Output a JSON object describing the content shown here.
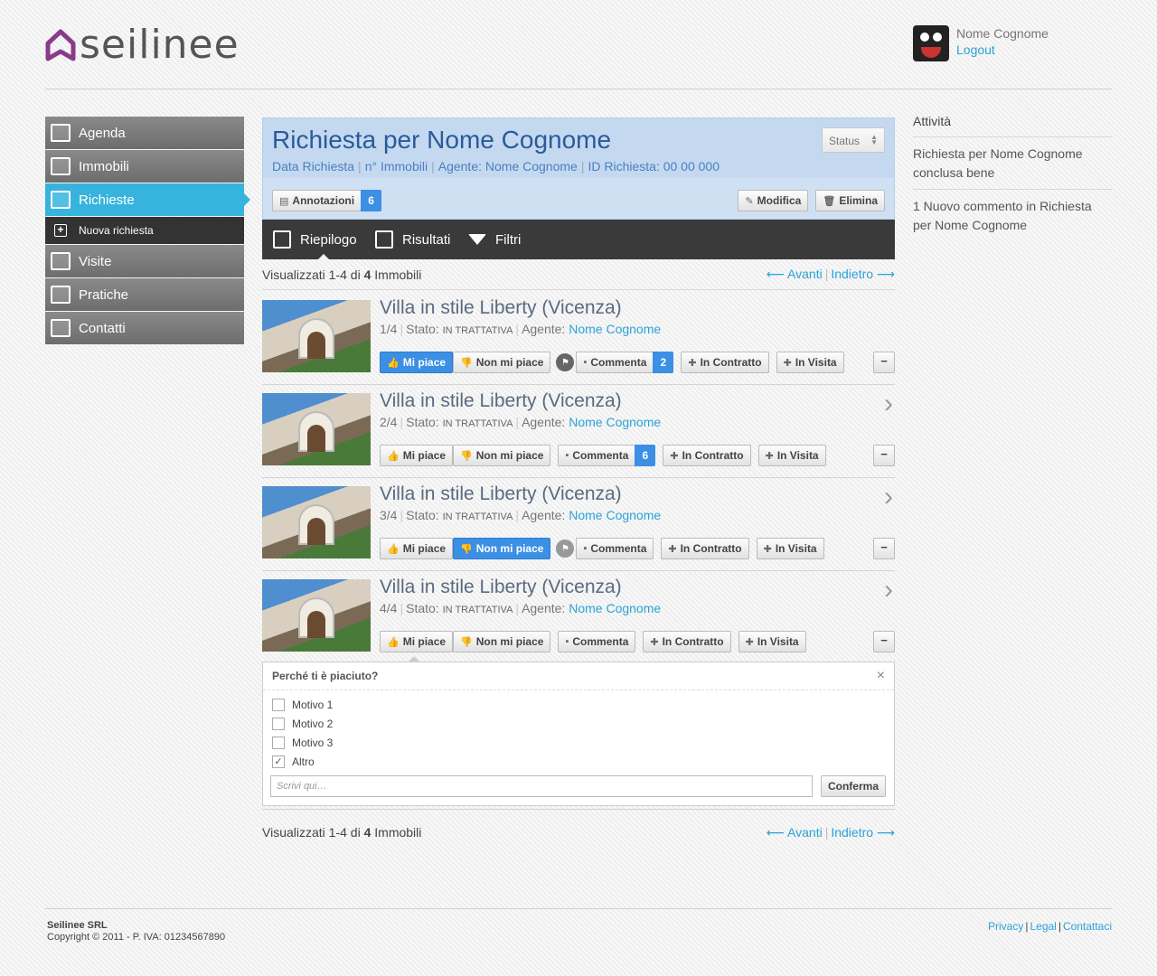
{
  "brand": {
    "logo_text": "seilinee",
    "accent": "#36b4dd",
    "logo_color": "#8a3a8a"
  },
  "user": {
    "name": "Nome Cognome",
    "logout": "Logout"
  },
  "sidebar": {
    "items": [
      {
        "label": "Agenda",
        "icon": "calendar-icon"
      },
      {
        "label": "Immobili",
        "icon": "building-icon"
      },
      {
        "label": "Richieste",
        "icon": "request-icon",
        "active": true
      },
      {
        "label": "Nuova richiesta",
        "icon": "plus-icon",
        "sub": true
      },
      {
        "label": "Visite",
        "icon": "visit-icon"
      },
      {
        "label": "Pratiche",
        "icon": "document-icon"
      },
      {
        "label": "Contatti",
        "icon": "person-icon"
      }
    ]
  },
  "request": {
    "title": "Richiesta per Nome Cognome",
    "meta": [
      "Data Richiesta",
      "n° Immobili",
      "Agente: Nome Cognome",
      "ID Richiesta: 00 00 000"
    ],
    "status_label": "Status",
    "annotations_label": "Annotazioni",
    "annotations_count": "6",
    "edit_label": "Modifica",
    "delete_label": "Elimina"
  },
  "tabs": [
    "Riepilogo",
    "Risultati",
    "Filtri"
  ],
  "pager": {
    "text_pre": "Visualizzati 1-4 di",
    "count": "4",
    "text_post": "Immobili",
    "prev": "⟵ Avanti",
    "next": "Indietro ⟶"
  },
  "properties": [
    {
      "title": "Villa in stile Liberty (Vicenza)",
      "index": "1/4",
      "state_label": "Stato:",
      "state": "IN TRATTATIVA",
      "agent_label": "Agente:",
      "agent": "Nome Cognome",
      "comments": "2"
    },
    {
      "title": "Villa in stile Liberty (Vicenza)",
      "index": "2/4",
      "state_label": "Stato:",
      "state": "IN TRATTATIVA",
      "agent_label": "Agente:",
      "agent": "Nome Cognome",
      "comments": "6"
    },
    {
      "title": "Villa in stile Liberty (Vicenza)",
      "index": "3/4",
      "state_label": "Stato:",
      "state": "IN TRATTATIVA",
      "agent_label": "Agente:",
      "agent": "Nome Cognome",
      "comments": ""
    },
    {
      "title": "Villa in stile Liberty (Vicenza)",
      "index": "4/4",
      "state_label": "Stato:",
      "state": "IN TRATTATIVA",
      "agent_label": "Agente:",
      "agent": "Nome Cognome",
      "comments": ""
    }
  ],
  "actions": {
    "like": "Mi piace",
    "dislike": "Non mi piace",
    "comment": "Commenta",
    "contract": "In Contratto",
    "visit": "In Visita",
    "collapse": "−"
  },
  "popup": {
    "question": "Perché ti è piaciuto?",
    "close": "×",
    "options": [
      {
        "label": "Motivo 1",
        "checked": false
      },
      {
        "label": "Motivo 2",
        "checked": false
      },
      {
        "label": "Motivo 3",
        "checked": false
      },
      {
        "label": "Altro",
        "checked": true
      }
    ],
    "placeholder": "Scrivi qui…",
    "confirm": "Conferma"
  },
  "activity": {
    "title": "Attività",
    "entries": [
      "Richiesta per Nome Cognome conclusa bene",
      "1 Nuovo commento in  Richiesta per Nome Cognome"
    ]
  },
  "footer": {
    "company": "Seilinee SRL",
    "copyright": "Copyright © 2011 - P. IVA: 01234567890",
    "links": [
      "Privacy",
      "Legal",
      "Contattaci"
    ]
  }
}
